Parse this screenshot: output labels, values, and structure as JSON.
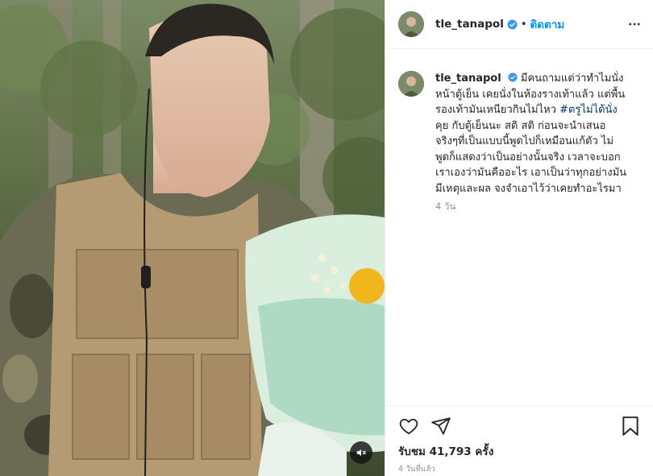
{
  "post": {
    "username": "tle_tanapol",
    "follow_label": "ติดตาม",
    "separator": "•",
    "caption_username": "tle_tanapol",
    "caption_lines": [
      "มีคนถามแต่ว่าทำไมนั่ง",
      "หน้าตู้เย็น เคยนั่งในห้องรางเท้าแล้ว แต่พื้น",
      "รองเท้ามันเหนียวกินไม่ไหว ",
      "คุย กับตู้เย็นนะ สติ สติ ก่อนจะนำเสนอ",
      "จริงๆที่เป็นแบบนี้พูดไปก็เหมือนแก้ตัว ไม่",
      "พูดก็แสดงว่าเป็นอย่างนั้นจริง เวลาจะบอก",
      "เราเองว่ามันคืออะไร เอาเป็นว่าทุกอย่างมัน",
      "มีเหตุและผล จงจำเอาไว้ว่าเคยทำอะไรมา"
    ],
    "hashtag": "#ตรูไม่ได้นั่ง",
    "caption_age": "4 วัน",
    "views_label": "รับชม",
    "views_count": "41,793",
    "views_unit": "ครั้ง",
    "timestamp": "4 วันที่แล้ว"
  },
  "icons": {
    "verified": "verified-badge-icon",
    "more": "more-options-icon",
    "like": "heart-icon",
    "share": "paper-plane-icon",
    "save": "bookmark-icon",
    "mute": "muted-speaker-icon"
  },
  "colors": {
    "link_blue": "#0095f6",
    "hashtag": "#00376b",
    "muted_text": "#8e8e8e",
    "verified": "#3897f0",
    "border": "#efefef"
  }
}
